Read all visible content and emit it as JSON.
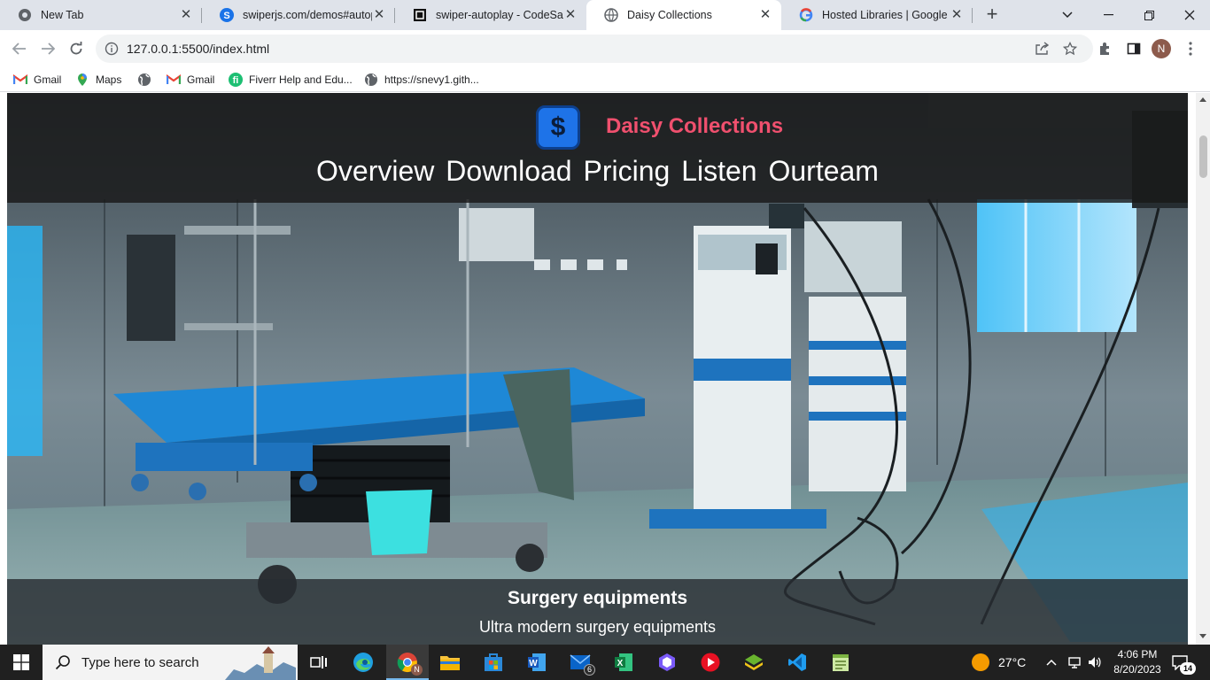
{
  "browser": {
    "tabs": [
      {
        "title": "New Tab",
        "icon": "chrome-icon"
      },
      {
        "title": "swiperjs.com/demos#autopla",
        "icon": "swiper-icon"
      },
      {
        "title": "swiper-autoplay - CodeSandb",
        "icon": "codesandbox-icon"
      },
      {
        "title": "Daisy Collections",
        "icon": "globe-icon",
        "active": true
      },
      {
        "title": "Hosted Libraries  |  Google fo",
        "icon": "google-icon"
      }
    ],
    "url": "127.0.0.1:5500/index.html",
    "profile_initial": "N",
    "bookmarks": [
      {
        "label": "Gmail",
        "icon": "gmail-icon"
      },
      {
        "label": "Maps",
        "icon": "maps-icon"
      },
      {
        "label": "",
        "icon": "globe-icon"
      },
      {
        "label": "Gmail",
        "icon": "gmail-icon"
      },
      {
        "label": "Fiverr Help and Edu...",
        "icon": "fiverr-icon"
      },
      {
        "label": "https://snevy1.gith...",
        "icon": "globe-icon"
      }
    ]
  },
  "site": {
    "brand": "Daisy Collections",
    "logo_symbol": "$",
    "nav": [
      "Overview",
      "Download",
      "Pricing",
      "Listen",
      "Ourteam"
    ],
    "slide": {
      "title": "Surgery equipments",
      "subtitle": "Ultra modern surgery equipments"
    },
    "colors": {
      "brand": "#f0506e",
      "logo": "#1e73e8",
      "header_bg": "#191919"
    }
  },
  "taskbar": {
    "search_placeholder": "Type here to search",
    "weather": "27°C",
    "time": "4:06 PM",
    "date": "8/20/2023",
    "notification_count": "14",
    "mail_badge": "6"
  }
}
